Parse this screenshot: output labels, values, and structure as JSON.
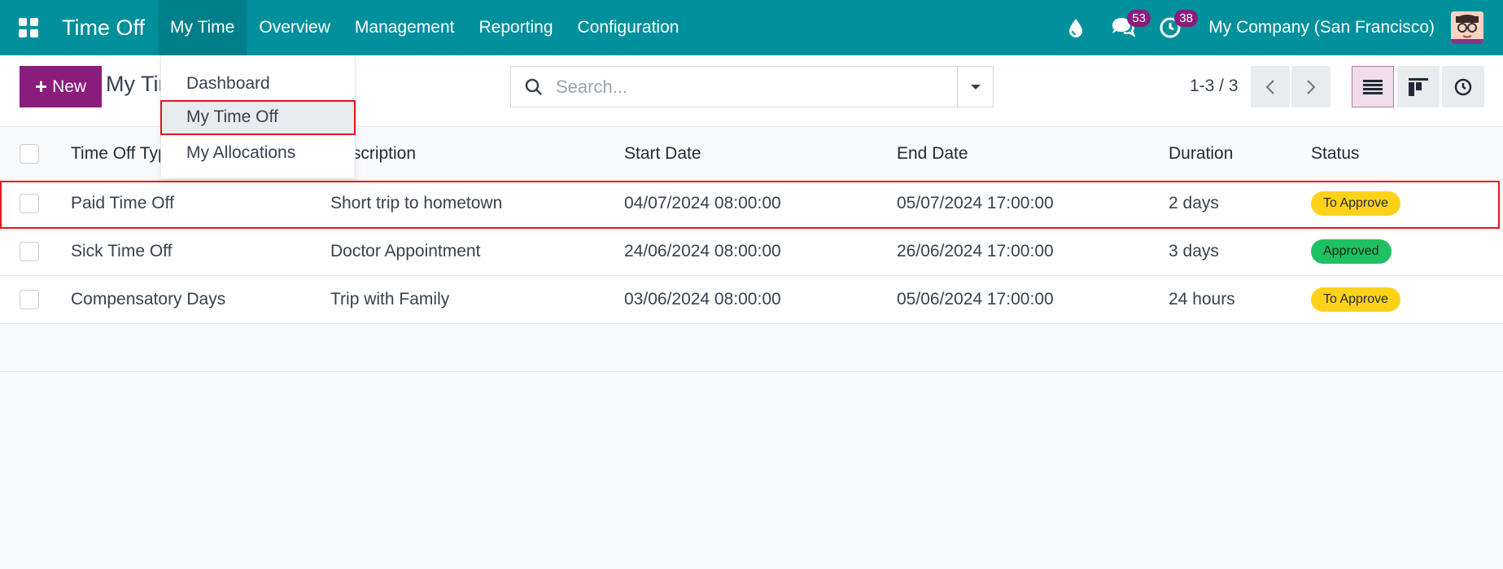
{
  "topnav": {
    "app_title": "Time Off",
    "menu": [
      "My Time",
      "Overview",
      "Management",
      "Reporting",
      "Configuration"
    ],
    "messages_count": "53",
    "activities_count": "38",
    "company": "My Company (San Francisco)"
  },
  "dropdown": {
    "items": [
      "Dashboard",
      "My Time Off",
      "My Allocations"
    ]
  },
  "controls": {
    "new_label": "New",
    "breadcrumb": "My Time Off",
    "search_placeholder": "Search...",
    "pager": "1-3 / 3"
  },
  "table": {
    "columns": [
      "Time Off Type",
      "Description",
      "Start Date",
      "End Date",
      "Duration",
      "Status"
    ],
    "rows": [
      {
        "type": "Paid Time Off",
        "description": "Short trip to hometown",
        "start": "04/07/2024 08:00:00",
        "end": "05/07/2024 17:00:00",
        "duration": "2 days",
        "status": "To Approve"
      },
      {
        "type": "Sick Time Off",
        "description": "Doctor Appointment",
        "start": "24/06/2024 08:00:00",
        "end": "26/06/2024 17:00:00",
        "duration": "3 days",
        "status": "Approved"
      },
      {
        "type": "Compensatory Days",
        "description": "Trip with Family",
        "start": "03/06/2024 08:00:00",
        "end": "05/06/2024 17:00:00",
        "duration": "24 hours",
        "status": "To Approve"
      }
    ]
  },
  "colors": {
    "topbar": "#00909c",
    "primary": "#8a1c7c",
    "to_approve": "#ffd21a",
    "approved": "#1ec161",
    "highlight": "#e3151e"
  }
}
